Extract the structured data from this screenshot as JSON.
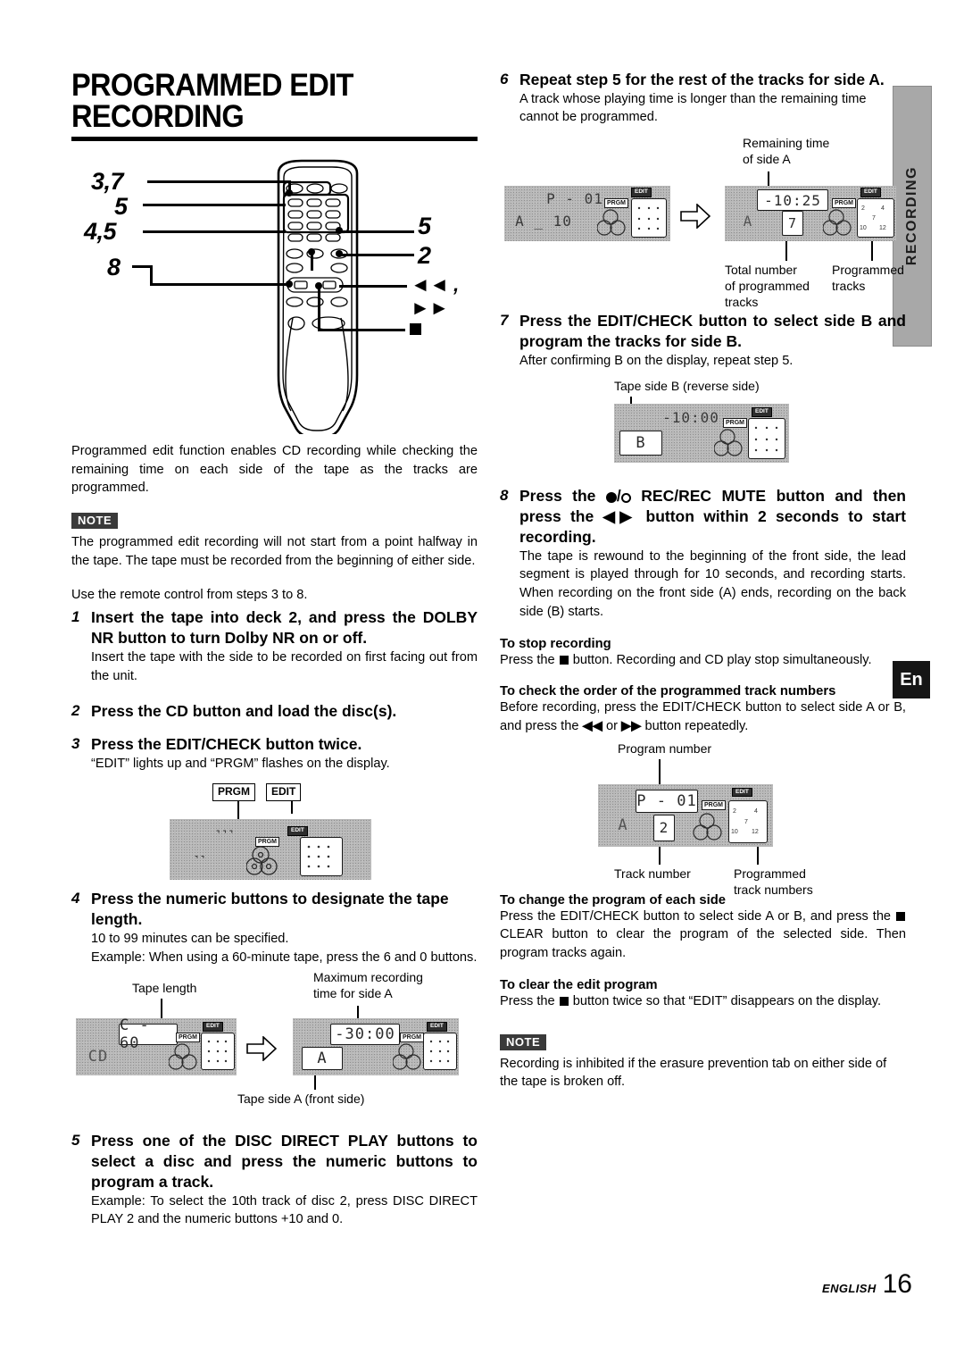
{
  "page": {
    "title": "PROGRAMMED EDIT RECORDING",
    "footer_language": "ENGLISH",
    "footer_page": "16",
    "side_tab_section": "RECORDING",
    "side_tab_language": "En"
  },
  "remote_figure": {
    "callouts": [
      {
        "name": "edit-check",
        "label": "3,7"
      },
      {
        "name": "disc-direct-play",
        "label": "5"
      },
      {
        "name": "numeric-buttons",
        "label": "4,5"
      },
      {
        "name": "rec-rec-mute",
        "label": "8"
      },
      {
        "name": "plus-ten",
        "label": "5"
      },
      {
        "name": "cd-button",
        "label": "2"
      },
      {
        "name": "skip-buttons",
        "label": "◄◄ , ►►"
      }
    ]
  },
  "intro": "Programmed edit function enables CD recording while checking the remaining time on each side of the tape as the tracks are programmed.",
  "note_label": "NOTE",
  "note_1": "The programmed edit recording will not start from a point halfway in the tape. The tape must be recorded from the beginning of either side.",
  "remote_hint": "Use the remote control from steps 3 to 8.",
  "steps": [
    {
      "num": "1",
      "head": "Insert the tape into deck 2, and press the DOLBY NR button to turn Dolby NR on or off.",
      "body": "Insert the tape with the side to be recorded on first facing out from the unit."
    },
    {
      "num": "2",
      "head": "Press the CD button and load the disc(s).",
      "body": ""
    },
    {
      "num": "3",
      "head": "Press the EDIT/CHECK button twice.",
      "body": "“EDIT” lights up and “PRGM” flashes on the display."
    },
    {
      "num": "4",
      "head": "Press the numeric buttons to designate the tape length.",
      "body": "10 to 99 minutes can be specified.\nExample: When using a 60-minute tape, press the 6 and 0 buttons."
    },
    {
      "num": "5",
      "head": "Press one of the DISC DIRECT PLAY buttons to select a disc and press the numeric buttons to program a track.",
      "body": "Example: To select the 10th track of disc 2, press DISC DIRECT PLAY 2 and the numeric buttons +10 and 0."
    },
    {
      "num": "6",
      "head": "Repeat step 5 for the rest of the tracks for side A.",
      "body": "A track whose playing time is longer than the remaining time cannot be programmed."
    },
    {
      "num": "7",
      "head": "Press the EDIT/CHECK button to select side B and program the tracks for side B.",
      "body": "After confirming B on the display, repeat step 5."
    },
    {
      "num": "8",
      "head_pre": "Press the ",
      "head_mid": " REC/REC MUTE button and then press the ",
      "head_post": " button within 2 seconds to start recording.",
      "num8": "8",
      "body": "The tape is rewound to the beginning of the front side, the lead segment is played through for 10 seconds, and recording starts.  When recording on the front side (A) ends, recording on the back side (B) starts."
    }
  ],
  "fig_prgm_edit": {
    "label_prgm": "PRGM",
    "label_edit": "EDIT",
    "display_top": "˺˺˺",
    "display_bottom": "˺˺"
  },
  "fig_tape_length": {
    "cap_tape_length": "Tape length",
    "cap_max_time": "Maximum recording\ntime for side A",
    "cap_side_a": "Tape side A (front side)",
    "left_main": "C - 60",
    "left_sub": "CD",
    "right_main": "-30:00",
    "right_sub": "A"
  },
  "fig_remaining": {
    "cap_remaining": "Remaining time\nof side A",
    "cap_total": "Total number\nof programmed\ntracks",
    "cap_programmed": "Programmed\ntracks",
    "left_main": "P - 01",
    "left_sub": "A _ 10",
    "right_main": "-10:25",
    "right_sub": "A",
    "right_count": "7"
  },
  "fig_side_b": {
    "cap_side_b": "Tape side B (reverse side)",
    "main": "-10:00",
    "sub": "B"
  },
  "fig_program_number": {
    "cap_program_number": "Program number",
    "cap_track_number": "Track number",
    "cap_programmed_tracks": "Programmed\ntrack numbers",
    "main": "P - 01",
    "sub": "A",
    "count": "2"
  },
  "sections": [
    {
      "head": "To stop recording",
      "body_pre": "Press the ",
      "body_post": " button. Recording and CD play stop simultaneously."
    },
    {
      "head": "To check the order of the programmed track numbers",
      "body_pre": "Before recording, press the EDIT/CHECK button to select side A or B, and press the ",
      "body_mid": " or ",
      "body_post": " button repeatedly."
    },
    {
      "head": "To change the program of each side",
      "body_pre": "Press the EDIT/CHECK button to select side A or B, and press the ",
      "body_post": " CLEAR button to clear the program of the selected side. Then program tracks again."
    },
    {
      "head": "To clear the edit program",
      "body_pre": "Press the ",
      "body_post": " button twice so that “EDIT” disappears on the display."
    }
  ],
  "note_2": "Recording is inhibited if the erasure prevention tab on either side of the tape is broken off."
}
